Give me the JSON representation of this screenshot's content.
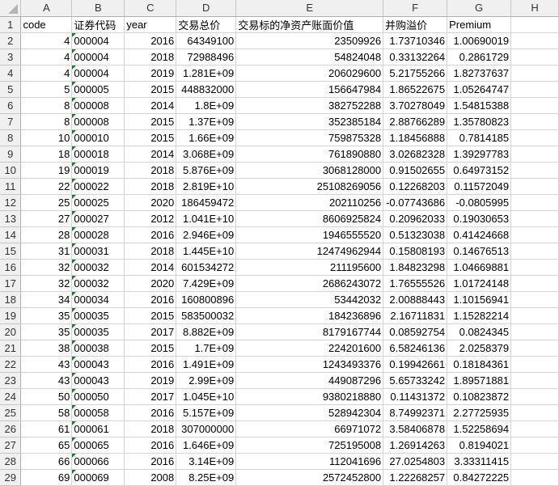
{
  "columns": [
    "A",
    "B",
    "C",
    "D",
    "E",
    "F",
    "G",
    "H"
  ],
  "header": [
    "code",
    "证券代码",
    "year",
    "交易总价",
    "交易标的净资产账面价值",
    "并购溢价",
    "Premium",
    ""
  ],
  "rows": [
    [
      "4",
      "000004",
      "2016",
      "64349100",
      "23509926",
      "1.73710346",
      "1.00690019"
    ],
    [
      "4",
      "000004",
      "2018",
      "72988496",
      "54824048",
      "0.33132264",
      "0.2861729"
    ],
    [
      "4",
      "000004",
      "2019",
      "1.281E+09",
      "206029600",
      "5.21755266",
      "1.82737637"
    ],
    [
      "5",
      "000005",
      "2015",
      "448832000",
      "156647984",
      "1.86522675",
      "1.05264747"
    ],
    [
      "8",
      "000008",
      "2014",
      "1.8E+09",
      "382752288",
      "3.70278049",
      "1.54815388"
    ],
    [
      "8",
      "000008",
      "2015",
      "1.37E+09",
      "352385184",
      "2.88766289",
      "1.35780823"
    ],
    [
      "10",
      "000010",
      "2015",
      "1.66E+09",
      "759875328",
      "1.18456888",
      "0.7814185"
    ],
    [
      "18",
      "000018",
      "2014",
      "3.068E+09",
      "761890880",
      "3.02682328",
      "1.39297783"
    ],
    [
      "19",
      "000019",
      "2018",
      "5.876E+09",
      "3068128000",
      "0.91502655",
      "0.64973152"
    ],
    [
      "22",
      "000022",
      "2018",
      "2.819E+10",
      "25108269056",
      "0.12268203",
      "0.11572049"
    ],
    [
      "25",
      "000025",
      "2020",
      "186459472",
      "202110256",
      "-0.07743686",
      "-0.0805995"
    ],
    [
      "27",
      "000027",
      "2012",
      "1.041E+10",
      "8606925824",
      "0.20962033",
      "0.19030653"
    ],
    [
      "28",
      "000028",
      "2016",
      "2.946E+09",
      "1946555520",
      "0.51323038",
      "0.41424668"
    ],
    [
      "31",
      "000031",
      "2018",
      "1.445E+10",
      "12474962944",
      "0.15808193",
      "0.14676513"
    ],
    [
      "32",
      "000032",
      "2014",
      "601534272",
      "211195600",
      "1.84823298",
      "1.04669881"
    ],
    [
      "32",
      "000032",
      "2020",
      "7.429E+09",
      "2686243072",
      "1.76555526",
      "1.01724148"
    ],
    [
      "34",
      "000034",
      "2016",
      "160800896",
      "53442032",
      "2.00888443",
      "1.10156941"
    ],
    [
      "35",
      "000035",
      "2015",
      "583500032",
      "184236896",
      "2.16711831",
      "1.15282214"
    ],
    [
      "35",
      "000035",
      "2017",
      "8.882E+09",
      "8179167744",
      "0.08592754",
      "0.0824345"
    ],
    [
      "38",
      "000038",
      "2015",
      "1.7E+09",
      "224201600",
      "6.58246136",
      "2.0258379"
    ],
    [
      "43",
      "000043",
      "2016",
      "1.491E+09",
      "1243493376",
      "0.19942661",
      "0.18184361"
    ],
    [
      "43",
      "000043",
      "2019",
      "2.99E+09",
      "449087296",
      "5.65733242",
      "1.89571881"
    ],
    [
      "50",
      "000050",
      "2017",
      "1.045E+10",
      "9380218880",
      "0.11431372",
      "0.10823872"
    ],
    [
      "58",
      "000058",
      "2016",
      "5.157E+09",
      "528942304",
      "8.74992371",
      "2.27725935"
    ],
    [
      "61",
      "000061",
      "2018",
      "307000000",
      "66971072",
      "3.58406878",
      "1.52258694"
    ],
    [
      "65",
      "000065",
      "2016",
      "1.646E+09",
      "725195008",
      "1.26914263",
      "0.8194021"
    ],
    [
      "66",
      "000066",
      "2016",
      "3.14E+09",
      "112041696",
      "27.0254803",
      "3.33311415"
    ],
    [
      "69",
      "000069",
      "2008",
      "8.25E+09",
      "2572452800",
      "1.22268257",
      "0.84272225"
    ]
  ]
}
